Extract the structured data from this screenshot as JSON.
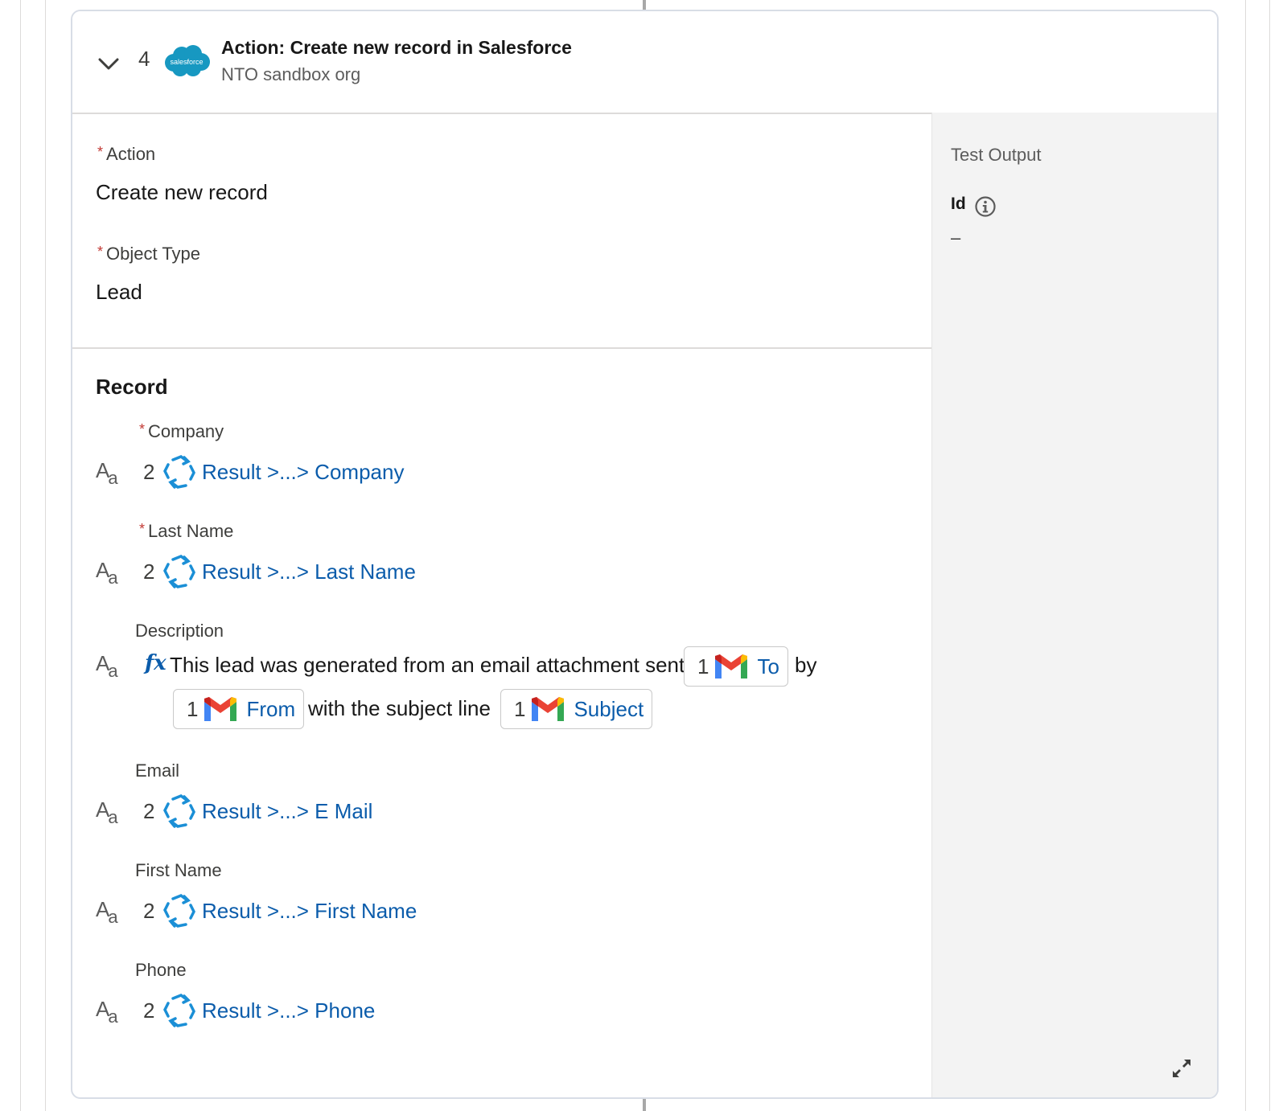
{
  "header": {
    "step_number": "4",
    "title": "Action: Create new record in Salesforce",
    "subtitle": "NTO sandbox org",
    "logo_text": "salesforce"
  },
  "action": {
    "label": "Action",
    "value": "Create new record"
  },
  "object_type": {
    "label": "Object Type",
    "value": "Lead"
  },
  "record": {
    "title": "Record",
    "fields": [
      {
        "label": "Company",
        "required": true,
        "step": "2",
        "ref": "Result >...> Company"
      },
      {
        "label": "Last Name",
        "required": true,
        "step": "2",
        "ref": "Result >...> Last Name"
      },
      {
        "label": "Email",
        "required": false,
        "step": "2",
        "ref": "Result >...> E Mail"
      },
      {
        "label": "First Name",
        "required": false,
        "step": "2",
        "ref": "Result >...> First Name"
      },
      {
        "label": "Phone",
        "required": false,
        "step": "2",
        "ref": "Result >...> Phone"
      }
    ],
    "description": {
      "label": "Description",
      "fx": "fx",
      "text1": "This lead was generated from an email attachment sent to",
      "text2": "by",
      "text3": "with the subject line",
      "pills": [
        {
          "step": "1",
          "label": "To"
        },
        {
          "step": "1",
          "label": "From"
        },
        {
          "step": "1",
          "label": "Subject"
        }
      ]
    }
  },
  "test_output": {
    "title": "Test Output",
    "id_label": "Id",
    "id_value": "–"
  },
  "icons": {
    "collapse": "chevron-down-icon",
    "text_type": "text-type-icon",
    "automation": "automation-icon",
    "gmail": "gmail-icon",
    "info": "info-icon",
    "expand": "expand-icon"
  },
  "colors": {
    "link": "#0b5cab",
    "required": "#c23934",
    "panel_bg": "#f3f3f3",
    "salesforce": "#1798c1"
  }
}
